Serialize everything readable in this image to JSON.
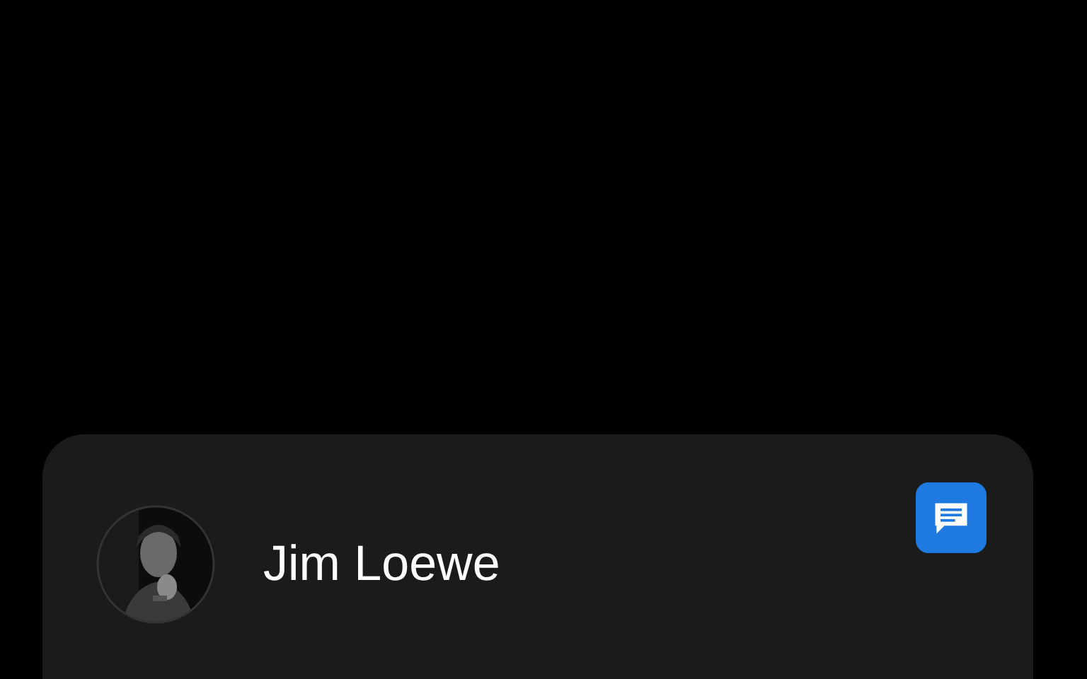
{
  "contact": {
    "name": "Jim Loewe"
  }
}
